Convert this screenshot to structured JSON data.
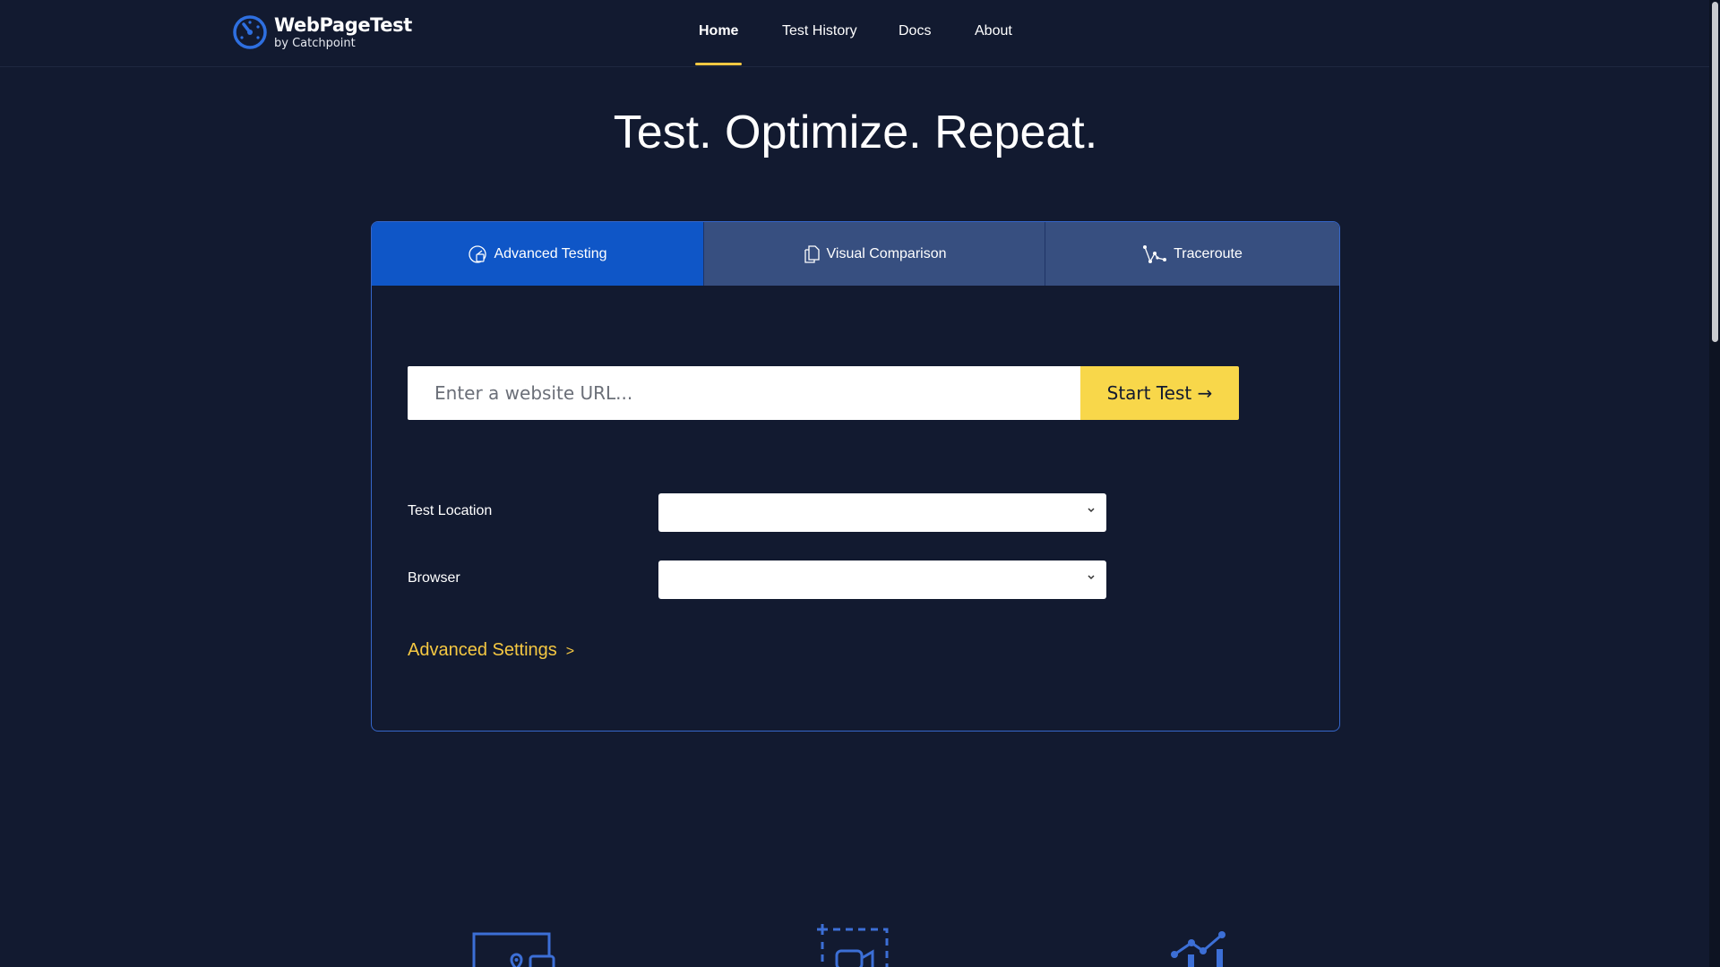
{
  "brand": {
    "title": "WebPageTest",
    "subtitle": "by Catchpoint",
    "icon": "stopwatch-logo-icon",
    "accent_color": "#2e6fe0"
  },
  "nav": {
    "items": [
      {
        "label": "Home",
        "active": true
      },
      {
        "label": "Test History",
        "active": false
      },
      {
        "label": "Docs",
        "active": false
      },
      {
        "label": "About",
        "active": false
      }
    ],
    "active_underline_color": "#f5c842"
  },
  "hero": {
    "title": "Test. Optimize. Repeat."
  },
  "tabs": [
    {
      "label": "Advanced Testing",
      "icon": "gauge-icon",
      "active": true
    },
    {
      "label": "Visual Comparison",
      "icon": "copy-pages-icon",
      "active": false
    },
    {
      "label": "Traceroute",
      "icon": "traceroute-icon",
      "active": false
    }
  ],
  "form": {
    "url_placeholder": "Enter a website URL...",
    "url_value": "",
    "start_label": "Start Test →",
    "test_location_label": "Test Location",
    "test_location_value": "",
    "browser_label": "Browser",
    "browser_value": "",
    "advanced_settings_label": "Advanced Settings",
    "advanced_settings_arrow": ">"
  },
  "colors": {
    "background": "#121a30",
    "tab_active": "#0f56c7",
    "tab_inactive": "#374f80",
    "start_button": "#f8d74a",
    "link": "#f5c842"
  },
  "features": {
    "icons": [
      "location-devices-icon",
      "video-capture-icon",
      "chart-trend-icon"
    ]
  }
}
